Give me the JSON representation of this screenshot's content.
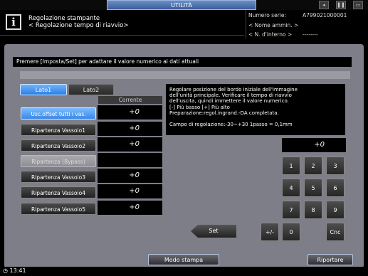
{
  "top": {
    "title": "UTILITÀ",
    "title_display": "UTILITÀ"
  },
  "header": {
    "line1": "Regolazione stampante",
    "line2": "< Regolazione tempo di riavvio>",
    "serial_label": "Numero serie:",
    "serial_value": "A799021000001",
    "admin_label": "< Nome ammin. >",
    "internal_label": "< N. d'interno >",
    "internal_value": "--------"
  },
  "message": "Premere [Imposta/Set] per adattare il valore numerico ai dati attuali",
  "tabs": {
    "lato1": "Lato1",
    "lato2": "Lato2"
  },
  "corrente_label": "Corrente",
  "rows": [
    {
      "label": "Usc.offset tutti i vas.",
      "value": "+0"
    },
    {
      "label": "Ripartenza Vassoio1",
      "value": "+0"
    },
    {
      "label": "Ripartenza Vassoio2",
      "value": "+0"
    },
    {
      "label": "Ripartenza (Bypass)",
      "value": ""
    },
    {
      "label": "Ripartenza Vassoio3",
      "value": "+0"
    },
    {
      "label": "Ripartenza Vassoio4",
      "value": "+0"
    },
    {
      "label": "Ripartenza Vassoio5",
      "value": "+0"
    }
  ],
  "description": {
    "text": "Regolare posizione del bordo iniziale dell'immagine\ndell'unità principale. Verificare il tempo di riavvio\ndell'uscita, quindi immettere il valore numerico.\n[-] Più basso [+] Più alto\nPreparazione:regol.ingrand.-DA completata.",
    "range": "Campo di regolazione:-30~+30 1passo = 0,1mm"
  },
  "input_value": "+0",
  "keypad": {
    "k1": "1",
    "k2": "2",
    "k3": "3",
    "k4": "4",
    "k5": "5",
    "k6": "6",
    "k7": "7",
    "k8": "8",
    "k9": "9",
    "k0": "0",
    "plusminus": "+/-",
    "clear": "Cnc"
  },
  "set_label": "Set",
  "footer": {
    "mode": "Modo stampa",
    "restore": "Riportare",
    "time": "13:41"
  },
  "colors": {
    "accent_blue": "#3a88e8",
    "panel_gray": "#7e7e88"
  }
}
